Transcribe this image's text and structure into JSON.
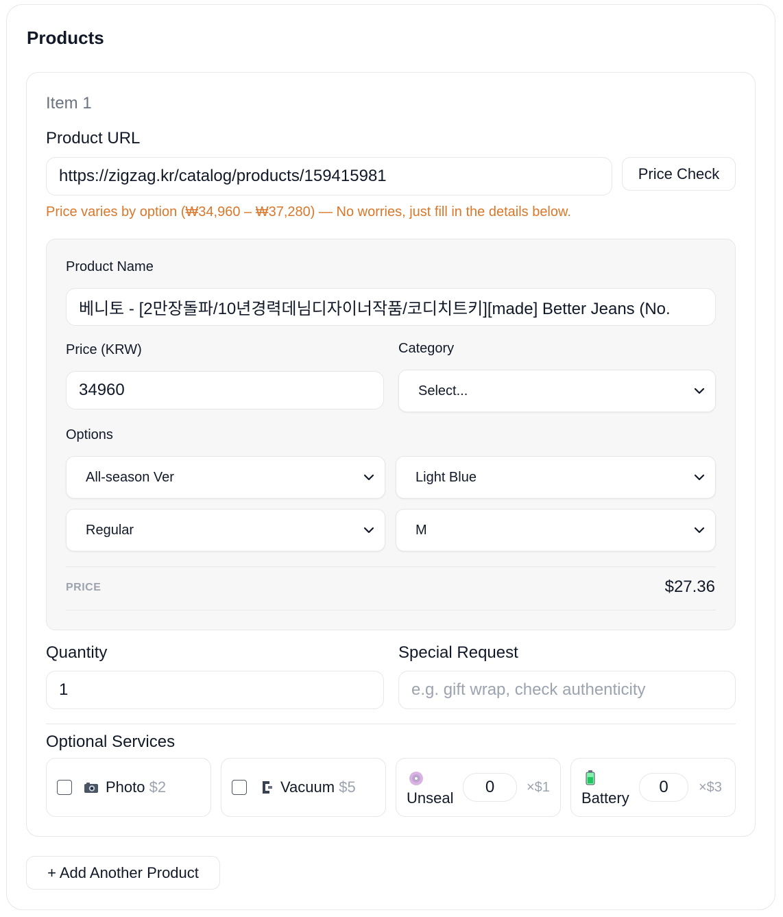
{
  "section_title": "Products",
  "item": {
    "label": "Item 1",
    "url_label": "Product URL",
    "url_value": "https://zigzag.kr/catalog/products/159415981",
    "price_check_label": "Price Check",
    "notice": "Price varies by option (₩34,960 – ₩37,280) — No worries, just fill in the details below.",
    "name_label": "Product Name",
    "name_value": "베니토 - [2만장돌파/10년경력데님디자이너작품/코디치트키][made] Better Jeans (No.",
    "price_label": "Price (KRW)",
    "price_value": "34960",
    "category_label": "Category",
    "category_value": "Select...",
    "options_label": "Options",
    "options": [
      "All-season Ver",
      "Light Blue",
      "Regular",
      "M"
    ],
    "price_summary_label": "PRICE",
    "price_summary_value": "$27.36",
    "quantity_label": "Quantity",
    "quantity_value": "1",
    "special_label": "Special Request",
    "special_placeholder": "e.g. gift wrap, check authenticity",
    "services_label": "Optional Services",
    "services": {
      "photo": {
        "icon": "camera-icon",
        "name": "Photo",
        "price": "$2"
      },
      "vacuum": {
        "icon": "clamp-icon",
        "name": "Vacuum",
        "price": "$5"
      },
      "unseal": {
        "icon": "disc-icon",
        "name": "Unseal",
        "count": "0",
        "mult": "×$1"
      },
      "battery": {
        "icon": "battery-icon",
        "name": "Battery",
        "count": "0",
        "mult": "×$3"
      }
    }
  },
  "add_button_label": "+ Add Another Product",
  "colors": {
    "notice": "#d9772b",
    "muted": "#9ca3af",
    "border": "#e5e7eb",
    "panel": "#f7f7f7"
  }
}
